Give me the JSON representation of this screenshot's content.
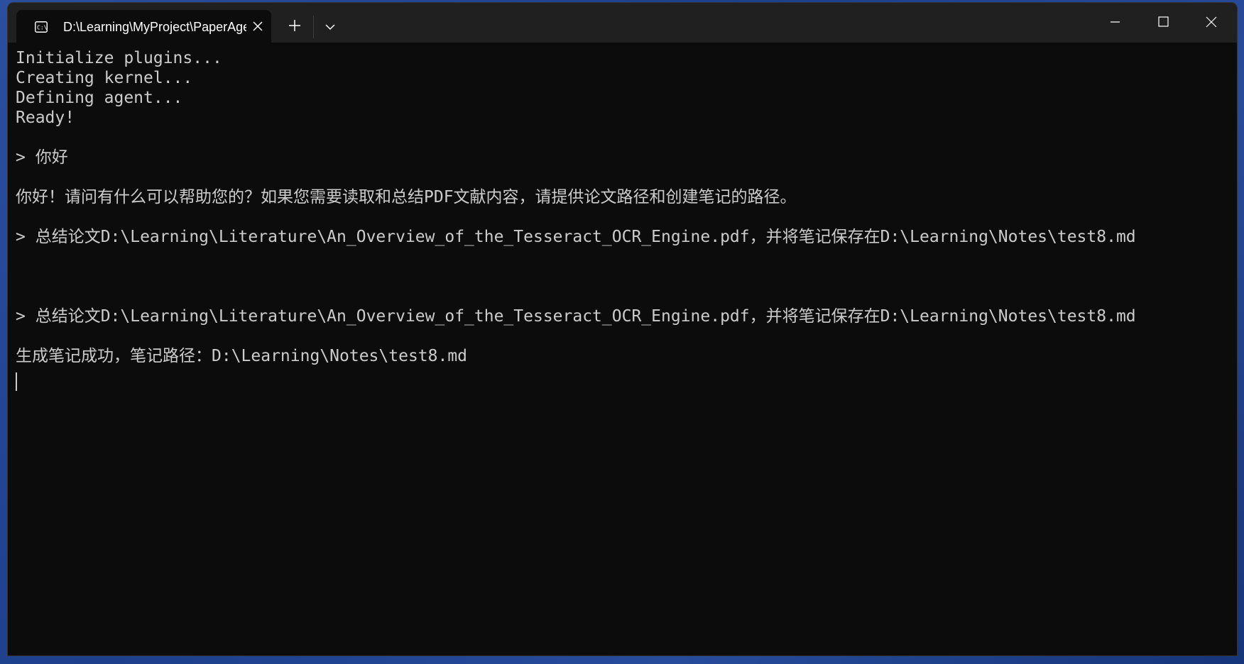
{
  "window": {
    "tab_title": "D:\\Learning\\MyProject\\PaperAgent",
    "tab_icon": "terminal-icon"
  },
  "titlebar": {
    "new_tab_icon": "plus-icon",
    "dropdown_icon": "chevron-down-icon",
    "minimize_icon": "minimize-icon",
    "maximize_icon": "maximize-icon",
    "close_icon": "close-icon"
  },
  "terminal": {
    "lines": [
      "Initialize plugins...",
      "Creating kernel...",
      "Defining agent...",
      "Ready!",
      "> 你好",
      "你好！请问有什么可以帮助您的？如果您需要读取和总结PDF文献内容，请提供论文路径和创建笔记的路径。",
      "> 总结论文D:\\Learning\\Literature\\An_Overview_of_the_Tesseract_OCR_Engine.pdf，并将笔记保存在D:\\Learning\\Notes\\test8.md",
      "> 总结论文D:\\Learning\\Literature\\An_Overview_of_the_Tesseract_OCR_Engine.pdf，并将笔记保存在D:\\Learning\\Notes\\test8.md",
      "生成笔记成功，笔记路径：D:\\Learning\\Notes\\test8.md"
    ]
  },
  "colors": {
    "terminal_bg": "#0c0c0c",
    "titlebar_bg": "#202020",
    "text": "#cccccc"
  }
}
